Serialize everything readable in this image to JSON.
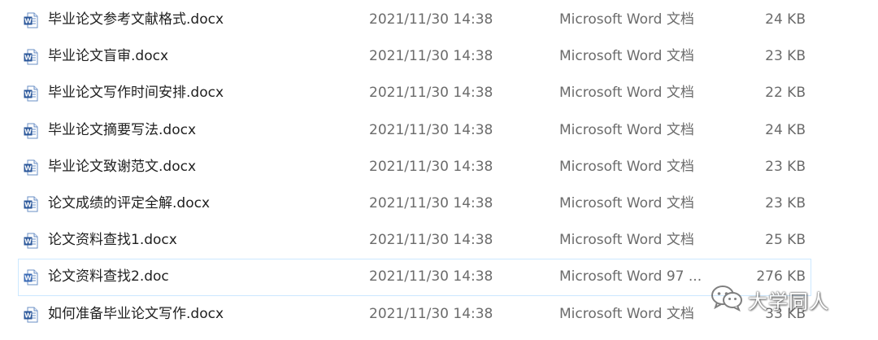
{
  "files": [
    {
      "name": "毕业论文参考文献格式.docx",
      "date": "2021/11/30 14:38",
      "type": "Microsoft Word 文档",
      "size": "24 KB",
      "icon": "word-doc-icon",
      "selected": false
    },
    {
      "name": "毕业论文盲审.docx",
      "date": "2021/11/30 14:38",
      "type": "Microsoft Word 文档",
      "size": "23 KB",
      "icon": "word-doc-icon",
      "selected": false
    },
    {
      "name": "毕业论文写作时间安排.docx",
      "date": "2021/11/30 14:38",
      "type": "Microsoft Word 文档",
      "size": "22 KB",
      "icon": "word-doc-icon",
      "selected": false
    },
    {
      "name": "毕业论文摘要写法.docx",
      "date": "2021/11/30 14:38",
      "type": "Microsoft Word 文档",
      "size": "24 KB",
      "icon": "word-doc-icon",
      "selected": false
    },
    {
      "name": "毕业论文致谢范文.docx",
      "date": "2021/11/30 14:38",
      "type": "Microsoft Word 文档",
      "size": "23 KB",
      "icon": "word-doc-icon",
      "selected": false
    },
    {
      "name": "论文成绩的评定全解.docx",
      "date": "2021/11/30 14:38",
      "type": "Microsoft Word 文档",
      "size": "23 KB",
      "icon": "word-doc-icon",
      "selected": false
    },
    {
      "name": "论文资料查找1.docx",
      "date": "2021/11/30 14:38",
      "type": "Microsoft Word 文档",
      "size": "25 KB",
      "icon": "word-doc-icon",
      "selected": false
    },
    {
      "name": "论文资料查找2.doc",
      "date": "2021/11/30 14:38",
      "type": "Microsoft Word 97 ...",
      "size": "276 KB",
      "icon": "word-97-doc-icon",
      "selected": true
    },
    {
      "name": "如何准备毕业论文写作.docx",
      "date": "2021/11/30 14:38",
      "type": "Microsoft Word 文档",
      "size": "33 KB",
      "icon": "word-doc-icon",
      "selected": false
    }
  ],
  "watermark": {
    "text": "大学同人",
    "icon": "wechat-icon"
  },
  "colors": {
    "word_blue": "#2b579a",
    "selection_border": "#cce8ff",
    "secondary_text": "#6b6b6b"
  }
}
